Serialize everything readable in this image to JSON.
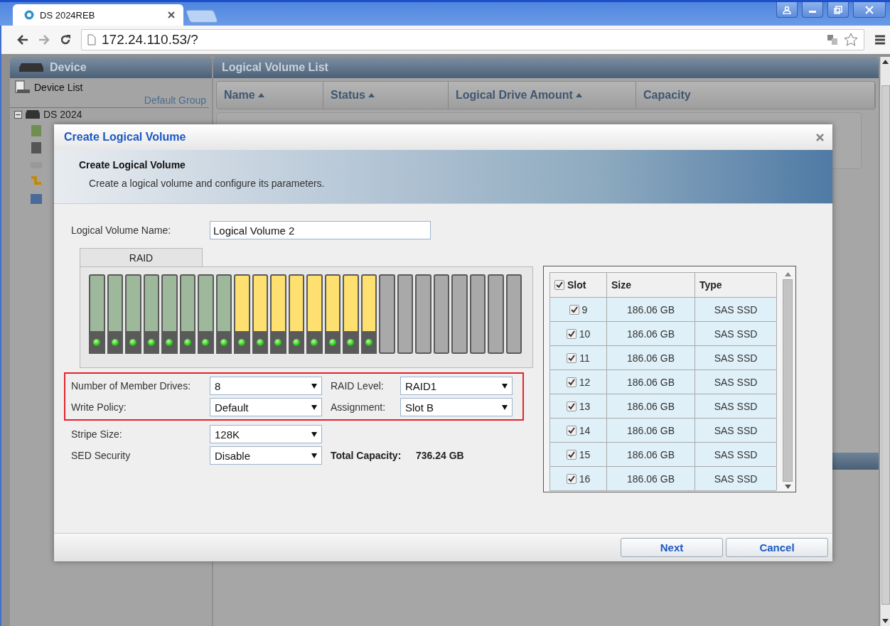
{
  "browser": {
    "tab_title": "DS 2024REB",
    "url": "172.24.110.53/?"
  },
  "sidebar": {
    "title": "Device",
    "device_list": "Device List",
    "group": "Default Group",
    "root": {
      "label": "DS 2024",
      "expanded": true
    }
  },
  "main": {
    "title": "Logical Volume List",
    "columns": [
      {
        "label": "Name",
        "sorted": true
      },
      {
        "label": "Status",
        "sorted": true
      },
      {
        "label": "Logical Drive Amount",
        "sorted": true
      },
      {
        "label": "Capacity",
        "sorted": false
      }
    ]
  },
  "dialog": {
    "title": "Create Logical Volume",
    "heading": "Create Logical Volume",
    "description": "Create a logical volume and configure its parameters.",
    "name_label": "Logical Volume Name:",
    "name_value": "Logical Volume 2",
    "raid_tab": "RAID",
    "bays": [
      {
        "occupied": true,
        "selected": false
      },
      {
        "occupied": true,
        "selected": false
      },
      {
        "occupied": true,
        "selected": false
      },
      {
        "occupied": true,
        "selected": false
      },
      {
        "occupied": true,
        "selected": false
      },
      {
        "occupied": true,
        "selected": false
      },
      {
        "occupied": true,
        "selected": false
      },
      {
        "occupied": true,
        "selected": false
      },
      {
        "occupied": true,
        "selected": true
      },
      {
        "occupied": true,
        "selected": true
      },
      {
        "occupied": true,
        "selected": true
      },
      {
        "occupied": true,
        "selected": true
      },
      {
        "occupied": true,
        "selected": true
      },
      {
        "occupied": true,
        "selected": true
      },
      {
        "occupied": true,
        "selected": true
      },
      {
        "occupied": true,
        "selected": true
      },
      {
        "occupied": false,
        "selected": false
      },
      {
        "occupied": false,
        "selected": false
      },
      {
        "occupied": false,
        "selected": false
      },
      {
        "occupied": false,
        "selected": false
      },
      {
        "occupied": false,
        "selected": false
      },
      {
        "occupied": false,
        "selected": false
      },
      {
        "occupied": false,
        "selected": false
      },
      {
        "occupied": false,
        "selected": false
      }
    ],
    "form_rows": [
      {
        "highlighted": true,
        "fields": [
          {
            "kind": "select",
            "label": "Number of Member Drives:",
            "value": "8"
          },
          {
            "kind": "select",
            "label": "RAID Level:",
            "value": "RAID1"
          }
        ]
      },
      {
        "highlighted": true,
        "fields": [
          {
            "kind": "select",
            "label": "Write Policy:",
            "value": "Default"
          },
          {
            "kind": "select",
            "label": "Assignment:",
            "value": "Slot B"
          }
        ]
      },
      {
        "highlighted": false,
        "fields": [
          {
            "kind": "select",
            "label": "Stripe Size:",
            "value": "128K"
          }
        ]
      },
      {
        "highlighted": false,
        "fields": [
          {
            "kind": "select",
            "label": "SED Security",
            "value": "Disable"
          },
          {
            "kind": "readout",
            "label": "Total Capacity:",
            "value": "736.24 GB"
          }
        ]
      }
    ],
    "drive_table": {
      "columns": [
        "Slot",
        "Size",
        "Type"
      ],
      "all_checked": true,
      "rows": [
        {
          "slot": "9",
          "checked": true,
          "size": "186.06 GB",
          "type": "SAS SSD"
        },
        {
          "slot": "10",
          "checked": true,
          "size": "186.06 GB",
          "type": "SAS SSD"
        },
        {
          "slot": "11",
          "checked": true,
          "size": "186.06 GB",
          "type": "SAS SSD"
        },
        {
          "slot": "12",
          "checked": true,
          "size": "186.06 GB",
          "type": "SAS SSD"
        },
        {
          "slot": "13",
          "checked": true,
          "size": "186.06 GB",
          "type": "SAS SSD"
        },
        {
          "slot": "14",
          "checked": true,
          "size": "186.06 GB",
          "type": "SAS SSD"
        },
        {
          "slot": "15",
          "checked": true,
          "size": "186.06 GB",
          "type": "SAS SSD"
        },
        {
          "slot": "16",
          "checked": true,
          "size": "186.06 GB",
          "type": "SAS SSD"
        }
      ]
    },
    "buttons": [
      {
        "label": "Next"
      },
      {
        "label": "Cancel"
      }
    ]
  }
}
